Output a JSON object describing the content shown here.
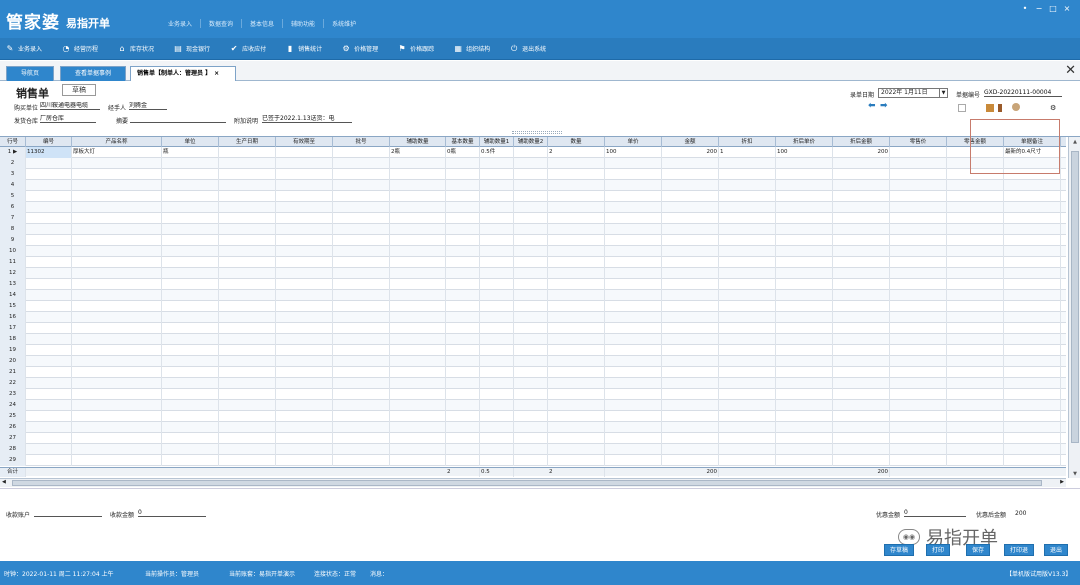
{
  "app": {
    "brand_main": "管家婆",
    "brand_sub": "易指开单",
    "top_nav": [
      "业务录入",
      "数据查询",
      "基本信息",
      "辅助功能",
      "系统维护"
    ],
    "window_controls": [
      "•",
      "−",
      "□",
      "×"
    ]
  },
  "toolbar": [
    {
      "icon": "pen-icon",
      "glyph": "✎",
      "label": "业务录入"
    },
    {
      "icon": "pie-icon",
      "glyph": "◔",
      "label": "经营历程"
    },
    {
      "icon": "house-icon",
      "glyph": "⌂",
      "label": "库存状况"
    },
    {
      "icon": "doc-icon",
      "glyph": "▤",
      "label": "现金银行"
    },
    {
      "icon": "check-icon",
      "glyph": "✔",
      "label": "应收应付"
    },
    {
      "icon": "bar-icon",
      "glyph": "▮",
      "label": "销售统计"
    },
    {
      "icon": "gear-icon",
      "glyph": "⚙",
      "label": "价格管理"
    },
    {
      "icon": "flag-icon",
      "glyph": "⚑",
      "label": "价格跟踪"
    },
    {
      "icon": "grid-icon",
      "glyph": "▦",
      "label": "组织结构"
    },
    {
      "icon": "exit-icon",
      "glyph": "⏻",
      "label": "退出系统"
    }
  ],
  "tabs": [
    {
      "label": "导航页"
    },
    {
      "label": "查看单据事例"
    },
    {
      "label": "销售单【制单人：管理员 】",
      "close": "×"
    }
  ],
  "form": {
    "title": "销售单",
    "stamp": "草稿",
    "buyer_label": "购买单位",
    "buyer_value": "四川鞍通电器电缆",
    "handler_label": "经手人",
    "handler_value": "刘腾金",
    "warehouse_label": "发货仓库",
    "warehouse_value": "厂房仓库",
    "summary_label": "摘要",
    "summary_value": "",
    "note_label": "附加说明",
    "note_value": "已签于2022.1.13送货：电",
    "date_label": "录单日期",
    "date_value": "2022年 1月11日",
    "docno_label": "单据编号",
    "docno_value": "GXD-20220111-00004"
  },
  "grid": {
    "columns": [
      "行号",
      "编号",
      "产品名称",
      "单位",
      "生产日期",
      "有效期至",
      "批号",
      "辅助数量",
      "基本数量",
      "辅助数量1",
      "辅助数量2",
      "数量",
      "单价",
      "金额",
      "折扣",
      "折后单价",
      "折后金额",
      "零售价",
      "零售金额",
      "单据备注"
    ],
    "row1": {
      "num": "1",
      "marker": "▶",
      "code": "11302",
      "name": "厚板大灯",
      "unit": "瓶",
      "aux_qty": "2瓶",
      "base_qty": "0瓶",
      "aux1": "0.5件",
      "qty": "2",
      "price": "100",
      "amount": "200",
      "discount": "1",
      "disc_price": "100",
      "disc_amount": "200",
      "remark": "最新的0.4尺寸"
    },
    "row_numbers": [
      "2",
      "3",
      "4",
      "5",
      "6",
      "7",
      "8",
      "9",
      "10",
      "11",
      "12",
      "13",
      "14",
      "15",
      "16",
      "17",
      "18",
      "19",
      "20",
      "21",
      "22",
      "23",
      "24",
      "25",
      "26",
      "27",
      "28",
      "29"
    ],
    "total": {
      "label": "合计",
      "base_qty": "2",
      "aux1": "0.5",
      "qty": "2",
      "amount": "200",
      "disc_amount": "200"
    }
  },
  "footer": {
    "account_label": "收款账户",
    "received_label": "收款金额",
    "received_value": "0",
    "discount_label": "优惠金额",
    "discount_value": "0",
    "after_discount_label": "优惠后金额",
    "after_discount_value": "200",
    "buttons": [
      "存草稿",
      "打印",
      "保存",
      "打印退",
      "退出"
    ],
    "watermark": "易指开单"
  },
  "status": {
    "time": "时钟：2022-01-11 周二 11:27:04 上午",
    "operator": "当前操作员：管理员",
    "account": "当前账套：易指开单演示",
    "connection": "连接状态：正常",
    "message": "消息：",
    "version": "【单机版试用版V13.3】"
  }
}
